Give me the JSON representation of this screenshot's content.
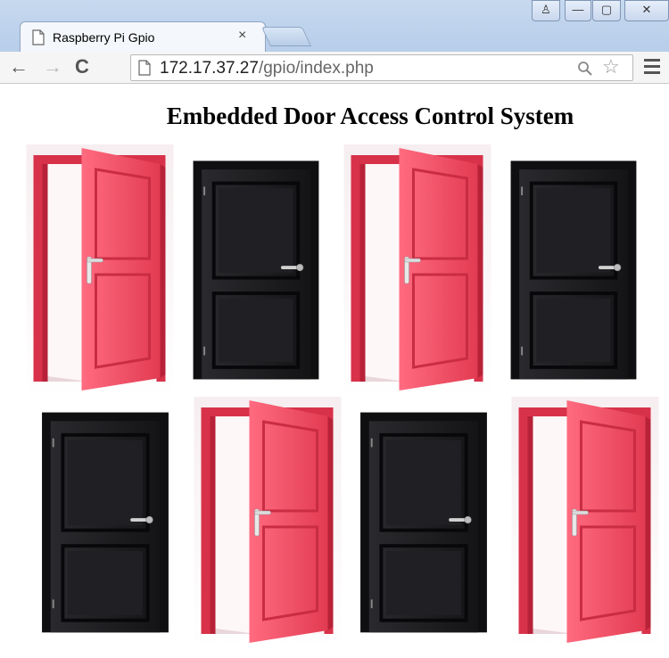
{
  "browser": {
    "tab_title": "Raspberry Pi Gpio",
    "tab_close": "×",
    "window_buttons": {
      "user": "♙",
      "minimize": "—",
      "maximize": "▢",
      "close": "✕"
    },
    "nav": {
      "back": "←",
      "forward": "→",
      "reload": "C"
    },
    "url_host": "172.17.37.27",
    "url_path": "/gpio/index.php",
    "star": "☆"
  },
  "page": {
    "title": "Embedded Door Access Control System"
  },
  "doors": [
    {
      "id": "door-1",
      "state": "open",
      "color": "#e8435a",
      "icon": "open-red-door"
    },
    {
      "id": "door-2",
      "state": "closed",
      "color": "#1c1c1f",
      "icon": "closed-black-door"
    },
    {
      "id": "door-3",
      "state": "open",
      "color": "#e8435a",
      "icon": "open-red-door"
    },
    {
      "id": "door-4",
      "state": "closed",
      "color": "#1c1c1f",
      "icon": "closed-black-door"
    },
    {
      "id": "door-5",
      "state": "closed",
      "color": "#1c1c1f",
      "icon": "closed-black-door"
    },
    {
      "id": "door-6",
      "state": "open",
      "color": "#e8435a",
      "icon": "open-red-door"
    },
    {
      "id": "door-7",
      "state": "closed",
      "color": "#1c1c1f",
      "icon": "closed-black-door"
    },
    {
      "id": "door-8",
      "state": "open",
      "color": "#e8435a",
      "icon": "open-red-door"
    }
  ]
}
